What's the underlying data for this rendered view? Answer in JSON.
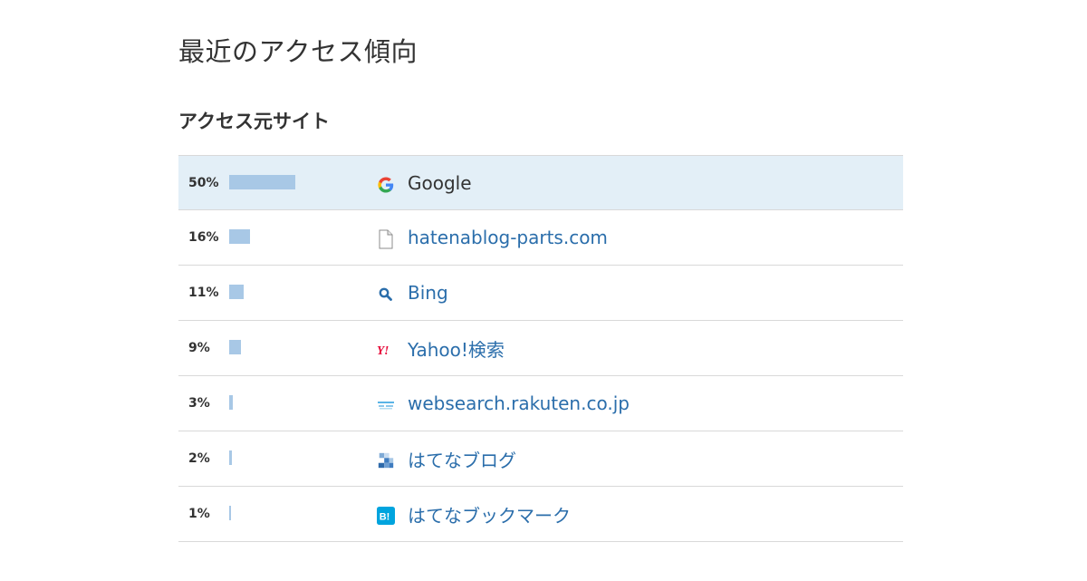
{
  "page": {
    "title": "最近のアクセス傾向"
  },
  "section": {
    "title": "アクセス元サイト"
  },
  "rows": [
    {
      "percent_label": "50%",
      "percent": 50,
      "name": "Google",
      "icon": "google-icon",
      "highlight": true
    },
    {
      "percent_label": "16%",
      "percent": 16,
      "name": "hatenablog-parts.com",
      "icon": "document-icon",
      "highlight": false
    },
    {
      "percent_label": "11%",
      "percent": 11,
      "name": "Bing",
      "icon": "search-icon",
      "highlight": false
    },
    {
      "percent_label": "9%",
      "percent": 9,
      "name": "Yahoo!検索",
      "icon": "yahoo-icon",
      "highlight": false
    },
    {
      "percent_label": "3%",
      "percent": 3,
      "name": "websearch.rakuten.co.jp",
      "icon": "rakuten-icon",
      "highlight": false
    },
    {
      "percent_label": "2%",
      "percent": 2,
      "name": "はてなブログ",
      "icon": "hatena-blog-icon",
      "highlight": false
    },
    {
      "percent_label": "1%",
      "percent": 1,
      "name": "はてなブックマーク",
      "icon": "hatena-bookmark-icon",
      "highlight": false
    }
  ],
  "colors": {
    "bar": "#a8c8e6",
    "link": "#2b6eab",
    "highlight_row": "#e3eff7",
    "yahoo_red": "#e60033",
    "bookmark_blue": "#00a4de"
  }
}
